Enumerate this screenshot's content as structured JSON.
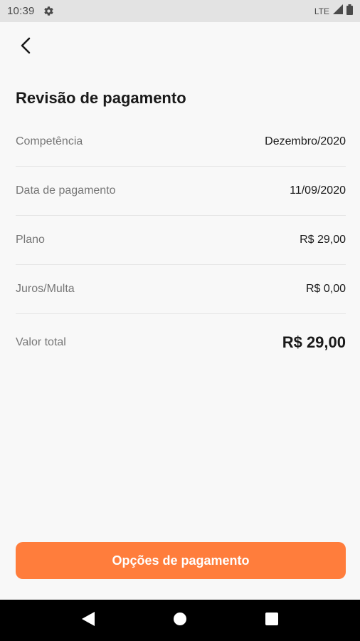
{
  "status_bar": {
    "time": "10:39",
    "network": "LTE",
    "icons": [
      "gear-icon",
      "signal-icon",
      "battery-icon"
    ]
  },
  "header": {
    "back_icon": "chevron-left-icon",
    "title": "Revisão de pagamento"
  },
  "summary": {
    "rows": [
      {
        "label": "Competência",
        "value": "Dezembro/2020"
      },
      {
        "label": "Data de pagamento",
        "value": "11/09/2020"
      },
      {
        "label": "Plano",
        "value": "R$ 29,00"
      },
      {
        "label": "Juros/Multa",
        "value": "R$ 0,00"
      }
    ],
    "total": {
      "label": "Valor total",
      "value": "R$ 29,00"
    }
  },
  "actions": {
    "payment_options_label": "Opções de pagamento"
  },
  "colors": {
    "accent": "#ff7d3c",
    "background": "#f8f8f8",
    "status_bar": "#e3e3e3"
  },
  "navigation": {
    "icons": [
      "back-triangle-icon",
      "home-circle-icon",
      "recents-square-icon"
    ]
  }
}
